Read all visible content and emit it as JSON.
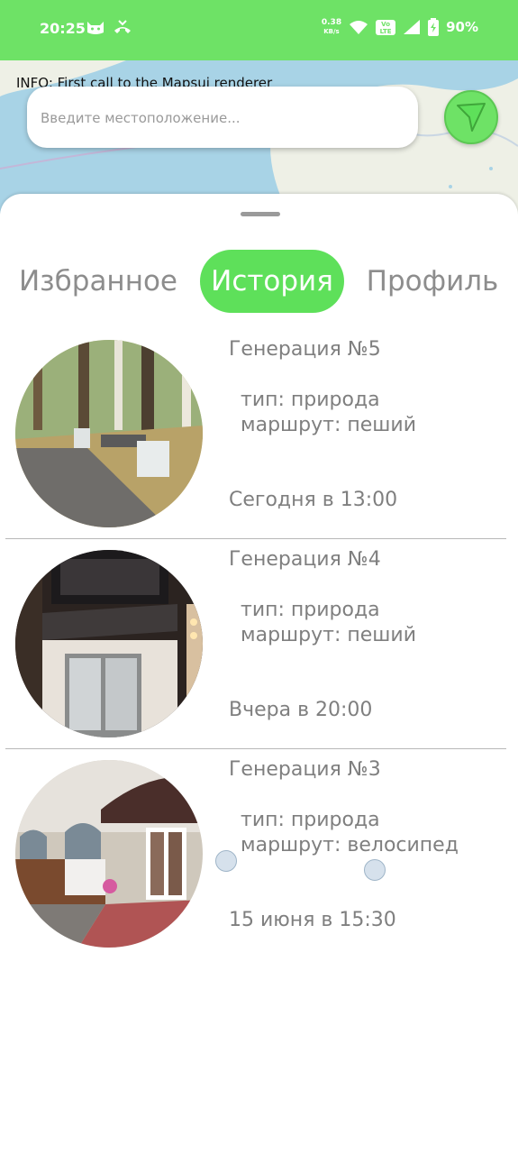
{
  "status_bar": {
    "time": "20:25",
    "net_speed_value": "0.38",
    "net_speed_unit": "KB/s",
    "network_badge": "Vo LTE",
    "battery": "90%",
    "icons": [
      "cat-icon",
      "missed-call-icon",
      "wifi-icon",
      "signal-icon",
      "battery-icon"
    ]
  },
  "map": {
    "info_text": "INFO: First call to the Mapsui renderer",
    "search_placeholder": "Введите местоположение...",
    "nav_icon": "navigation-arrow-icon"
  },
  "tabs": [
    {
      "label": "Избранное",
      "active": false
    },
    {
      "label": "История",
      "active": true
    },
    {
      "label": "Профиль",
      "active": false
    }
  ],
  "history": [
    {
      "title": "Генерация №5",
      "type": "тип: природа",
      "route": "маршрут: пеший",
      "date": "Сегодня в 13:00",
      "image": "park-photo"
    },
    {
      "title": "Генерация №4",
      "type": "тип: природа",
      "route": "маршрут: пеший",
      "date": "Вчера в 20:00",
      "image": "puppet-theatre-photo"
    },
    {
      "title": "Генерация №3",
      "type": "тип: природа",
      "route": "маршрут: велосипед",
      "date": "15 июня в 15:30",
      "image": "cafe-storefront-photo"
    }
  ],
  "colors": {
    "accent": "#5ee05a",
    "status_bar": "#6ee266",
    "text_muted": "#7f7f7f",
    "map_water": "#a8d3e6",
    "map_land": "#eef0e6"
  }
}
